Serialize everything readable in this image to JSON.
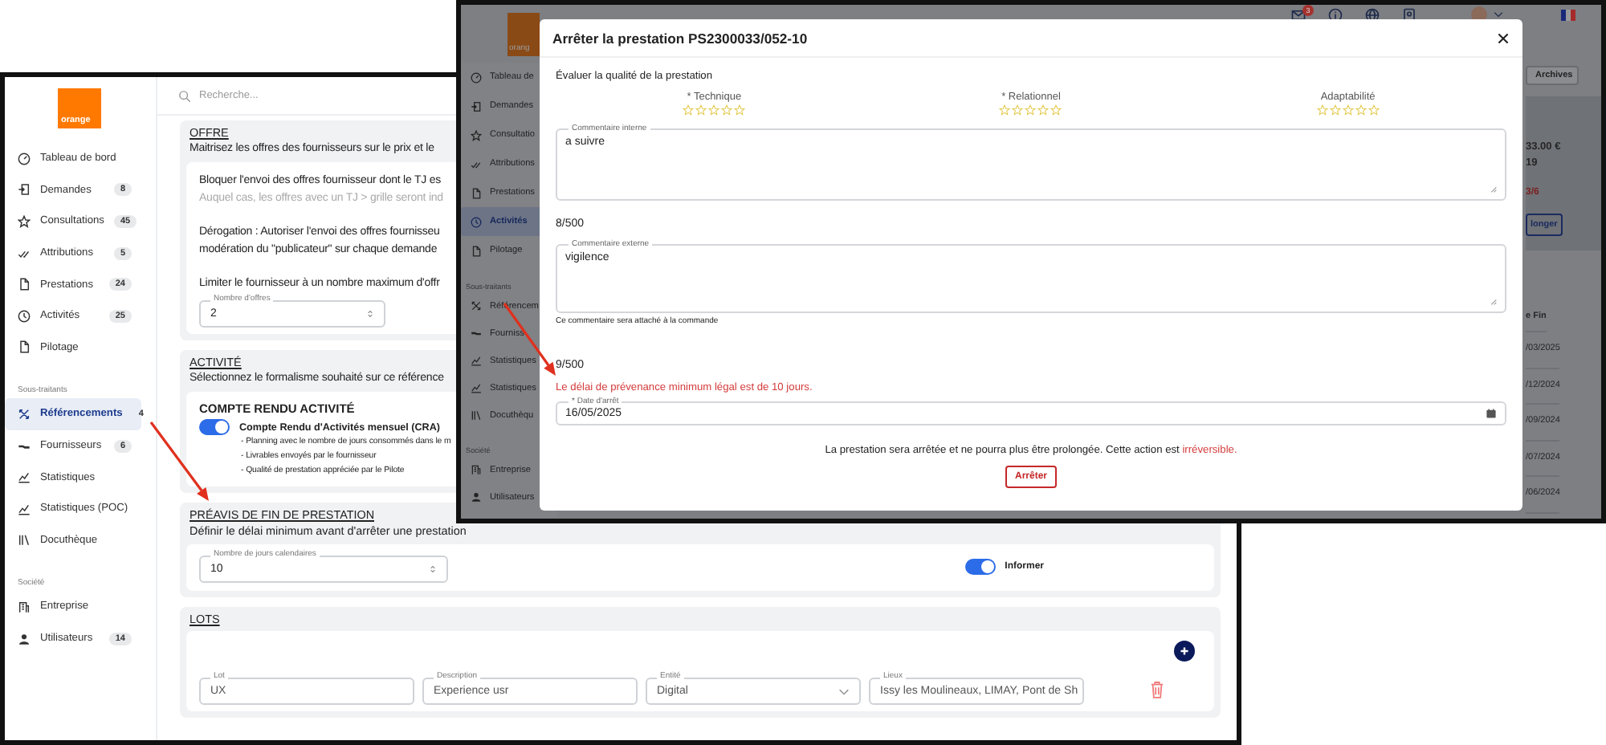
{
  "left_screen": {
    "sidebar": {
      "logo": "orange",
      "groups": [
        {
          "items": [
            {
              "label": "Tableau de bord",
              "selected": false
            },
            {
              "label": "Demandes",
              "badge": "8",
              "selected": false
            },
            {
              "label": "Consultations",
              "badge": "45",
              "selected": false
            },
            {
              "label": "Attributions",
              "badge": "5",
              "selected": false
            },
            {
              "label": "Prestations",
              "badge": "24",
              "selected": false
            },
            {
              "label": "Activités",
              "badge": "25",
              "selected": false
            },
            {
              "label": "Pilotage",
              "selected": false
            }
          ]
        },
        {
          "heading": "Sous-traitants",
          "items": [
            {
              "label": "Référencements",
              "badge": "4",
              "selected": true
            },
            {
              "label": "Fournisseurs",
              "badge": "6",
              "selected": false
            },
            {
              "label": "Statistiques",
              "selected": false
            },
            {
              "label": "Statistiques (POC)",
              "selected": false
            },
            {
              "label": "Docuthèque",
              "selected": false
            }
          ]
        },
        {
          "heading": "Société",
          "items": [
            {
              "label": "Entreprise",
              "selected": false
            },
            {
              "label": "Utilisateurs",
              "badge": "14",
              "selected": false
            }
          ]
        }
      ]
    },
    "search": {
      "placeholder": "Recherche..."
    },
    "sections": [
      {
        "kind": "offer",
        "title": "OFFRE",
        "subtitle": "Maitrisez les offres des fournisseurs sur le prix et le",
        "paragraphs": [
          {
            "lines": [
              {
                "kind": "text",
                "text": "Bloquer l'envoi des offres fournisseur dont le TJ es"
              },
              {
                "kind": "hint",
                "text": "Auquel cas, les offres avec un TJ > grille seront ind"
              }
            ]
          },
          {
            "lines": [
              {
                "kind": "text",
                "text": "Dérogation : Autoriser l'envoi des offres fournisseu"
              },
              {
                "kind": "text",
                "text": "modération du \"publicateur\" sur chaque demande"
              }
            ]
          },
          {
            "lines": [
              {
                "kind": "text",
                "text": "Limiter le fournisseur à un nombre maximum d'offr"
              }
            ],
            "field": {
              "label": "Nombre d'offres",
              "value": "2"
            }
          }
        ]
      },
      {
        "kind": "activity",
        "title": "ACTIVITÉ",
        "subtitle": "Sélectionnez le formalisme souhaité sur ce référence",
        "heading": "COMPTE RENDU ACTIVITÉ",
        "toggle": {
          "label": "Compte Rendu d'Activités mensuel (CRA)",
          "on": true
        },
        "bullets": [
          "- Planning avec le nombre de jours consommés dans le m",
          "- Livrables envoyés par le fournisseur",
          "- Qualité de prestation appréciée par le Pilote"
        ]
      },
      {
        "kind": "notice",
        "title": "PRÉAVIS DE FIN DE PRESTATION",
        "subtitle": "Définir le délai minimum avant d'arrêter une prestation",
        "field": {
          "label": "Nombre de jours calendaires",
          "value": "10"
        },
        "toggle": {
          "label": "Informer",
          "on": true
        }
      },
      {
        "kind": "lots",
        "title": "LOTS",
        "fields": [
          {
            "kind": "text",
            "label": "Lot",
            "value": "UX"
          },
          {
            "kind": "text",
            "label": "Description",
            "value": "Experience usr"
          },
          {
            "kind": "select",
            "label": "Entité",
            "value": "Digital"
          },
          {
            "kind": "text",
            "label": "Lieux",
            "value": "Issy les Moulineaux, LIMAY, Pont de Sh"
          }
        ]
      }
    ]
  },
  "right_screen": {
    "logo": "orang",
    "notification_count": "3",
    "sidebar": {
      "groups": [
        {
          "items": [
            {
              "label": "Tableau de",
              "selected": false
            },
            {
              "label": "Demandes",
              "selected": false
            },
            {
              "label": "Consultatio",
              "selected": false
            },
            {
              "label": "Attributions",
              "selected": false
            },
            {
              "label": "Prestations",
              "selected": false
            },
            {
              "label": "Activités",
              "selected": true
            },
            {
              "label": "Pilotage",
              "selected": false
            }
          ]
        },
        {
          "heading": "Sous-traitants",
          "items": [
            {
              "label": "Référencem",
              "selected": false
            },
            {
              "label": "Fourniss",
              "selected": false
            },
            {
              "label": "Statistiques",
              "selected": false
            },
            {
              "label": "Statistiques",
              "selected": false
            },
            {
              "label": "Docuthèqu",
              "selected": false
            }
          ]
        },
        {
          "heading": "Société",
          "items": [
            {
              "label": "Entreprise",
              "selected": false
            },
            {
              "label": "Utilisateurs",
              "selected": false
            }
          ]
        }
      ]
    },
    "panel": {
      "archives_button": "Archives",
      "amount": "33.00 €",
      "figure": "19",
      "ratio": "3/6",
      "button": "longer",
      "column_header": "e Fin",
      "dates": [
        "/03/2025",
        "/12/2024",
        "/09/2024",
        "/07/2024",
        "/06/2024"
      ]
    },
    "modal": {
      "title": "Arrêter la prestation PS2300033/052-10",
      "section_label": "Évaluer la qualité de la prestation",
      "ratings": [
        {
          "label": "* Technique",
          "stars": 0
        },
        {
          "label": "* Relationnel",
          "stars": 0
        },
        {
          "label": "Adaptabilité",
          "stars": 0
        }
      ],
      "internal_comment": {
        "label": "Commentaire interne",
        "value": "a suivre",
        "counter": "8/500"
      },
      "external_comment": {
        "label": "Commentaire externe",
        "value": "vigilence",
        "helper": "Ce commentaire sera attaché à la commande",
        "counter": "9/500"
      },
      "error": "Le délai de prévenance minimum légal est de 10 jours.",
      "date_field": {
        "label": "* Date d'arrêt",
        "value": "16/05/2025"
      },
      "warning": {
        "text": "La prestation sera arrêtée et ne pourra plus être prolongée. Cette action est",
        "emphasis": "irréversible."
      },
      "submit_button": "Arrêter"
    }
  }
}
